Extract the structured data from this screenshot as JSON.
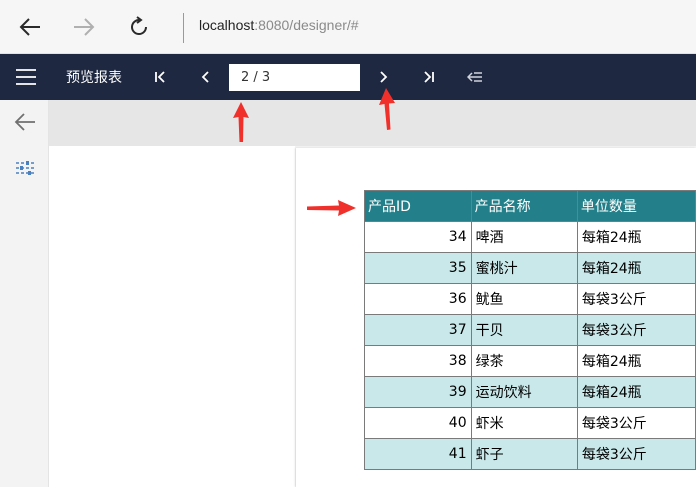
{
  "browser": {
    "address_host": "localhost",
    "address_path": ":8080/designer/#"
  },
  "toolbar": {
    "title": "预览报表",
    "page_value": "2 / 3"
  },
  "table": {
    "headers": [
      "产品ID",
      "产品名称",
      "单位数量"
    ],
    "rows": [
      {
        "id": "34",
        "name": "啤酒",
        "unit": "每箱24瓶"
      },
      {
        "id": "35",
        "name": "蜜桃汁",
        "unit": "每箱24瓶"
      },
      {
        "id": "36",
        "name": "鱿鱼",
        "unit": "每袋3公斤"
      },
      {
        "id": "37",
        "name": "干贝",
        "unit": "每袋3公斤"
      },
      {
        "id": "38",
        "name": "绿茶",
        "unit": "每箱24瓶"
      },
      {
        "id": "39",
        "name": "运动饮料",
        "unit": "每箱24瓶"
      },
      {
        "id": "40",
        "name": "虾米",
        "unit": "每袋3公斤"
      },
      {
        "id": "41",
        "name": "虾子",
        "unit": "每袋3公斤"
      }
    ]
  },
  "colors": {
    "toolbar_bg": "#1e2841",
    "header_bg": "#23808a",
    "alt_row_bg": "#c9e8ea",
    "annotation_red": "#f0302a"
  },
  "icons": {
    "back": "arrow-left-icon",
    "forward": "arrow-right-icon",
    "refresh": "refresh-icon",
    "menu": "hamburger-menu-icon",
    "first": "first-page-icon",
    "prev": "chevron-left-icon",
    "next": "chevron-right-icon",
    "last": "last-page-icon",
    "collapse": "collapse-sidebar-icon",
    "side_back": "arrow-left-icon",
    "parameters": "parameters-icon"
  }
}
